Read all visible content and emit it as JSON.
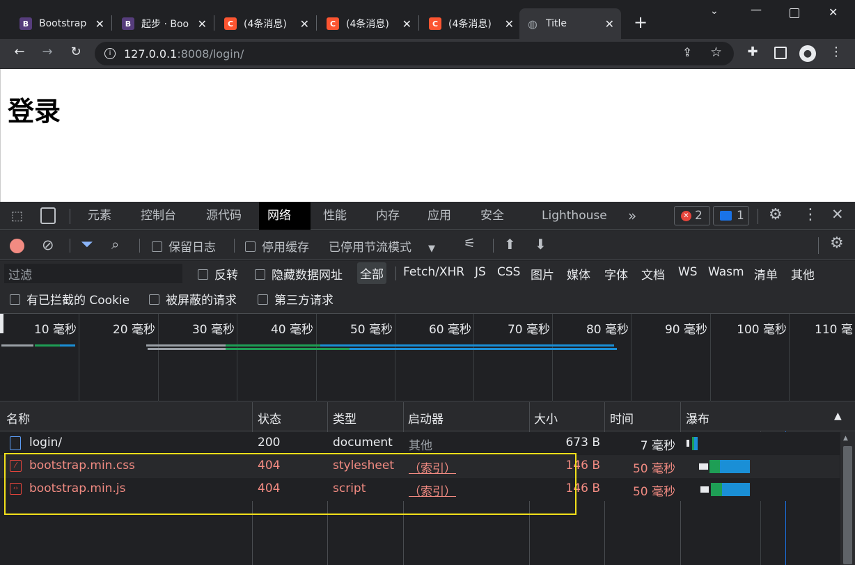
{
  "tabs": [
    {
      "title": "Bootstrap",
      "favicon": "B",
      "favicon_color": "#563d7c"
    },
    {
      "title": "起步 · Boo",
      "favicon": "B",
      "favicon_color": "#563d7c"
    },
    {
      "title": "(4条消息)",
      "favicon": "C",
      "favicon_color": "#fc5531"
    },
    {
      "title": "(4条消息)",
      "favicon": "C",
      "favicon_color": "#fc5531"
    },
    {
      "title": "(4条消息)",
      "favicon": "C",
      "favicon_color": "#fc5531"
    },
    {
      "title": "Title",
      "favicon": "globe-icon",
      "favicon_color": "#9aa0a6",
      "active": true
    }
  ],
  "address": {
    "host": "127.0.0.1",
    "path": ":8008/login/"
  },
  "page": {
    "heading": "登录"
  },
  "devtools": {
    "tabs": [
      "元素",
      "控制台",
      "源代码",
      "网络",
      "性能",
      "内存",
      "应用",
      "安全",
      "Lighthouse"
    ],
    "active_tab": "网络",
    "more": "»",
    "error_count": "2",
    "message_count": "1"
  },
  "network": {
    "preserve_log": "保留日志",
    "disable_cache": "停用缓存",
    "throttle": "已停用节流模式",
    "filter_placeholder": "过滤",
    "invert": "反转",
    "hide_data_urls": "隐藏数据网址",
    "types": [
      "全部",
      "Fetch/XHR",
      "JS",
      "CSS",
      "图片",
      "媒体",
      "字体",
      "文档",
      "WS",
      "Wasm",
      "清单",
      "其他"
    ],
    "blocked_cookies": "有已拦截的 Cookie",
    "blocked_requests": "被屏蔽的请求",
    "third_party": "第三方请求",
    "timeline_ticks": [
      "10 毫秒",
      "20 毫秒",
      "30 毫秒",
      "40 毫秒",
      "50 毫秒",
      "60 毫秒",
      "70 毫秒",
      "80 毫秒",
      "90 毫秒",
      "100 毫秒",
      "110 毫"
    ],
    "columns": [
      "名称",
      "状态",
      "类型",
      "启动器",
      "大小",
      "时间",
      "瀑布"
    ],
    "rows": [
      {
        "name": "login/",
        "status": "200",
        "type": "document",
        "initiator": "其他",
        "size": "673 B",
        "time": "7 毫秒",
        "error": false,
        "icon": "document-icon"
      },
      {
        "name": "bootstrap.min.css",
        "status": "404",
        "type": "stylesheet",
        "initiator": "（索引）",
        "size": "146 B",
        "time": "50 毫秒",
        "error": true,
        "icon": "stylesheet-icon"
      },
      {
        "name": "bootstrap.min.js",
        "status": "404",
        "type": "script",
        "initiator": "（索引）",
        "size": "146 B",
        "time": "50 毫秒",
        "error": true,
        "icon": "script-icon"
      }
    ]
  },
  "colors": {
    "highlight_box": "#f2e01a",
    "error": "#f28b82",
    "accent_blue": "#1a73e8"
  }
}
